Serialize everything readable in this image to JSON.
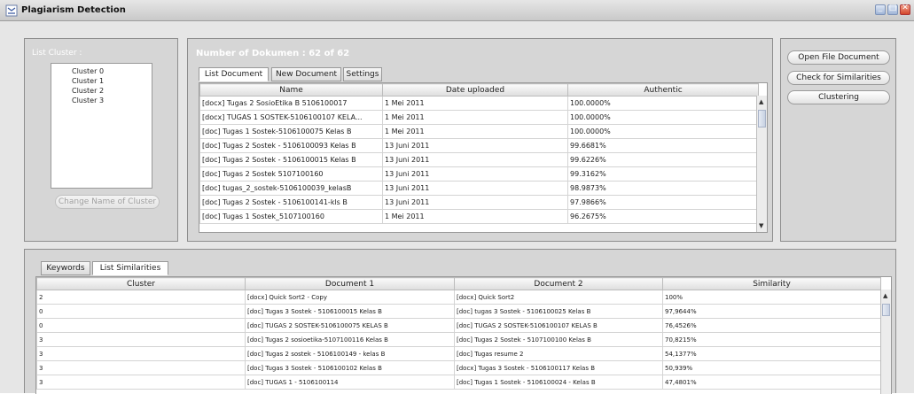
{
  "window": {
    "title": "Plagiarism Detection",
    "controls": [
      "minimize",
      "maximize",
      "close"
    ]
  },
  "cluster_panel": {
    "label": "List Cluster :",
    "clusters": [
      "Cluster 0",
      "Cluster 1",
      "Cluster 2",
      "Cluster 3"
    ],
    "change_name_button": "Change Name of Cluster"
  },
  "documents_panel": {
    "count_label": "Number of Dokumen : 62 of 62",
    "tabs": [
      "List Document",
      "New Document",
      "Settings"
    ],
    "columns": [
      "Name",
      "Date uploaded",
      "Authentic"
    ],
    "rows": [
      [
        "[docx] Tugas 2 SosioEtika B 5106100017",
        "1 Mei 2011",
        "100.0000%"
      ],
      [
        "[docx] TUGAS 1 SOSTEK-5106100107 KELA...",
        "1 Mei 2011",
        "100.0000%"
      ],
      [
        "[doc] Tugas 1 Sostek-5106100075 Kelas B",
        "1 Mei 2011",
        "100.0000%"
      ],
      [
        "[doc] Tugas 2 Sostek - 5106100093 Kelas B",
        "13 Juni 2011",
        "99.6681%"
      ],
      [
        "[doc] Tugas 2 Sostek - 5106100015 Kelas B",
        "13 Juni 2011",
        "99.6226%"
      ],
      [
        "[doc] Tugas 2 Sostek 5107100160",
        "13 Juni 2011",
        "99.3162%"
      ],
      [
        "[doc] tugas_2_sostek-5106100039_kelasB",
        "13 Juni 2011",
        "98.9873%"
      ],
      [
        "[doc] Tugas 2 Sostek - 5106100141-kls B",
        "13 Juni 2011",
        "97.9866%"
      ],
      [
        "[doc] Tugas 1 Sostek_5107100160",
        "1 Mei 2011",
        "96.2675%"
      ]
    ]
  },
  "actions_panel": {
    "open_file": "Open File Document",
    "check_similarities": "Check for Similarities",
    "clustering": "Clustering"
  },
  "similarity_panel": {
    "tabs": [
      "Keywords",
      "List Similarities"
    ],
    "columns": [
      "Cluster",
      "Document 1",
      "Document 2",
      "Similarity"
    ],
    "rows": [
      [
        "2",
        "[docx] Quick Sort2 - Copy",
        "[docx] Quick Sort2",
        "100%"
      ],
      [
        "0",
        "[doc] Tugas 3 Sostek - 5106100015 Kelas B",
        "[doc] tugas 3 Sostek - 5106100025 Kelas B",
        "97,9644%"
      ],
      [
        "0",
        "[doc] TUGAS 2 SOSTEK-5106100075 KELAS B",
        "[doc] TUGAS 2 SOSTEK-5106100107 KELAS B",
        "76,4526%"
      ],
      [
        "3",
        "[doc] Tugas 2 sosioetika-5107100116 Kelas B",
        "[doc] Tugas 2 Sostek - 5107100100 Kelas B",
        "70,8215%"
      ],
      [
        "3",
        "[doc] Tugas 2 sostek - 5106100149 - kelas B",
        "[doc] Tugas resume 2",
        "54,1377%"
      ],
      [
        "3",
        "[doc] Tugas 3 Sostek - 5106100102 Kelas B",
        "[docx] Tugas 3 Sostek - 5106100117 Kelas B",
        "50,939%"
      ],
      [
        "3",
        "[doc] TUGAS 1 - 5106100114",
        "[doc] Tugas 1 Sostek - 5106100024 - Kelas B",
        "47,4801%"
      ]
    ]
  },
  "colors": {
    "panel_bg": "#d6d6d6",
    "window_bg": "#e6e6e6",
    "label_text": "#ffffff"
  },
  "icons": [
    "app-icon",
    "scroll-up-icon",
    "scroll-down-icon"
  ]
}
